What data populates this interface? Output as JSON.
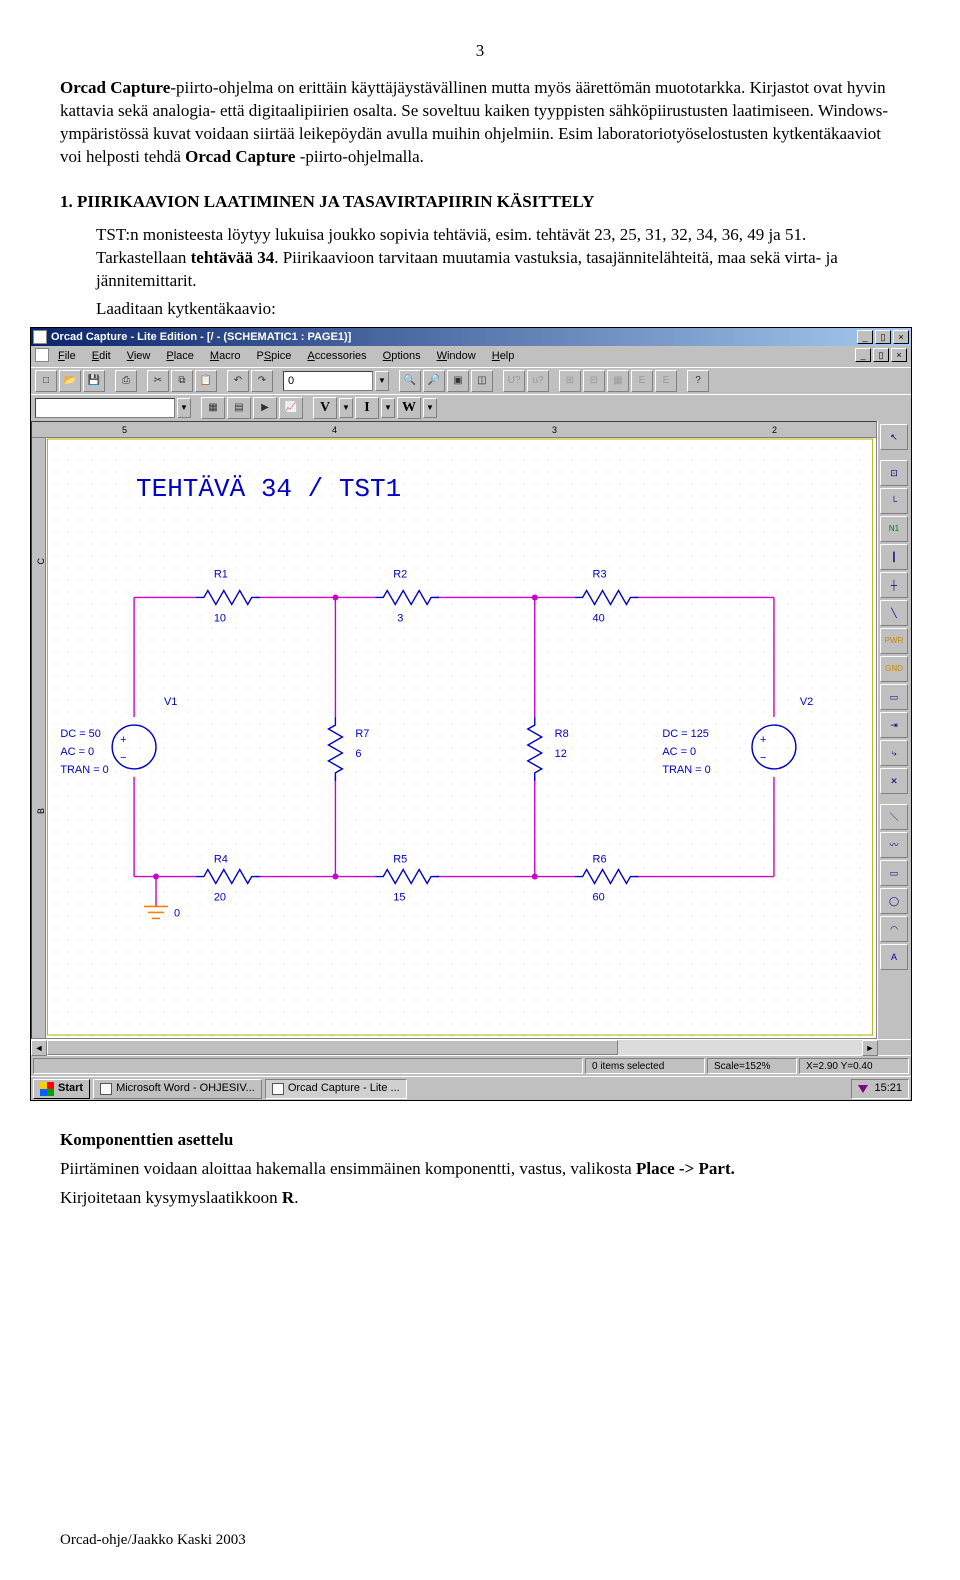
{
  "page_number": "3",
  "intro": {
    "p1a": "Orcad Capture",
    "p1b": "-piirto-ohjelma on erittäin käyttäjäystävällinen mutta myös äärettömän muototarkka. Kirjastot ovat hyvin kattavia sekä analogia- että digitaalipiirien osalta. Se soveltuu kaiken tyyppisten sähköpiirustusten laatimiseen. Windows-ympäristössä kuvat voidaan siirtää leikepöydän avulla muihin ohjelmiin. Esim laboratoriotyöselostusten kytkentäkaaviot voi helposti tehdä ",
    "p1c": "Orcad Capture",
    "p1d": " -piirto-ohjelmalla."
  },
  "section1_title": "1. PIIRIKAAVION LAATIMINEN JA TASAVIRTAPIIRIN KÄSITTELY",
  "section1": {
    "p1": "TST:n monisteesta löytyy lukuisa joukko sopivia tehtäviä, esim. tehtävät 23, 25, 31, 32, 34, 36, 49 ja 51. Tarkastellaan ",
    "p1b": "tehtävää 34",
    "p1c": ". Piirikaavioon tarvitaan muutamia vastuksia, tasajännitelähteitä, maa sekä virta- ja jännitemittarit.",
    "p2": "Laaditaan kytkentäkaavio:"
  },
  "app": {
    "title": "Orcad Capture - Lite Edition - [/ - (SCHEMATIC1 : PAGE1)]",
    "menus": [
      "File",
      "Edit",
      "View",
      "Place",
      "Macro",
      "PSpice",
      "Accessories",
      "Options",
      "Window",
      "Help"
    ],
    "toolbar2_letters": [
      "V",
      "I",
      "W"
    ],
    "zoom_value": "0",
    "ruler_top": [
      "5",
      "4",
      "3",
      "2"
    ],
    "ruler_left": [
      "C",
      "B"
    ],
    "schematic_title": "TEHTÄVÄ 34 / TST1",
    "components": {
      "R1": {
        "name": "R1",
        "value": "10"
      },
      "R2": {
        "name": "R2",
        "value": "3"
      },
      "R3": {
        "name": "R3",
        "value": "40"
      },
      "R4": {
        "name": "R4",
        "value": "20"
      },
      "R5": {
        "name": "R5",
        "value": "15"
      },
      "R6": {
        "name": "R6",
        "value": "60"
      },
      "R7": {
        "name": "R7",
        "value": "6"
      },
      "R8": {
        "name": "R8",
        "value": "12"
      },
      "V1": {
        "name": "V1",
        "dc": "DC = 50",
        "ac": "AC = 0",
        "tran": "TRAN = 0"
      },
      "V2": {
        "name": "V2",
        "dc": "DC = 125",
        "ac": "AC = 0",
        "tran": "TRAN = 0"
      },
      "gnd": "0"
    },
    "status": {
      "selected": "0 items selected",
      "scale": "Scale=152%",
      "coords": "X=2.90 Y=0.40"
    },
    "taskbar": {
      "start": "Start",
      "word": "Microsoft Word - OHJESIV...",
      "orcad": "Orcad Capture - Lite ...",
      "time": "15:21"
    }
  },
  "post": {
    "h": "Komponenttien asettelu",
    "p1": "Piirtäminen voidaan aloittaa hakemalla ensimmäinen komponentti, vastus, valikosta ",
    "p1b": "Place -> Part.",
    "p2a": "Kirjoitetaan kysymyslaatikkoon ",
    "p2b": "R",
    "p2c": "."
  },
  "footer": "Orcad-ohje/Jaakko Kaski 2003"
}
